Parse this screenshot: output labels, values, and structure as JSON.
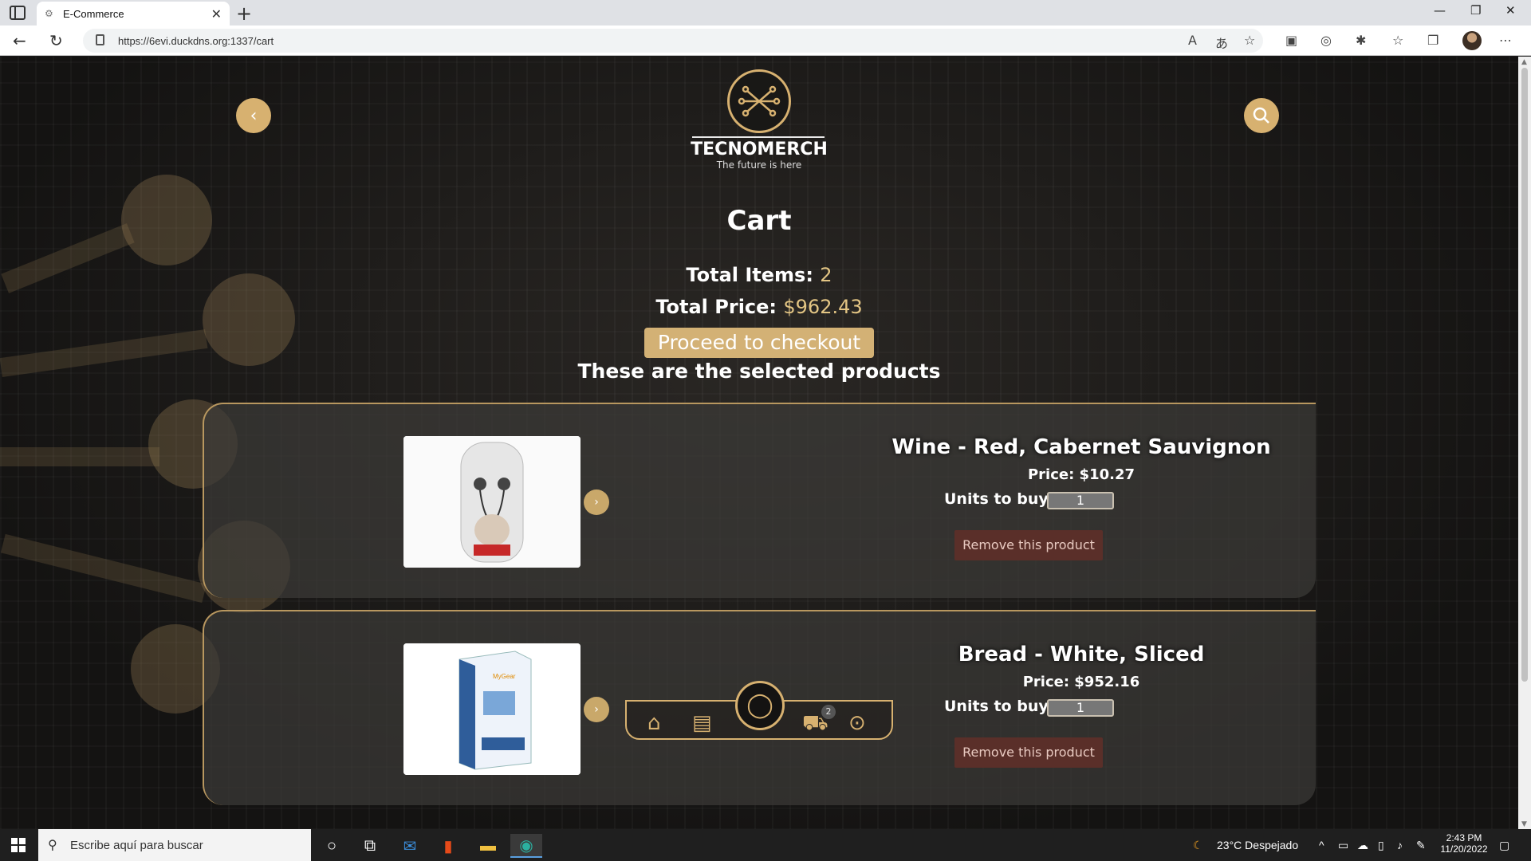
{
  "browser": {
    "tab_title": "E-Commerce",
    "tab_close": "✕",
    "new_tab": "+",
    "url": "https://6evi.duckdns.org:1337/cart",
    "window_controls": {
      "minimize": "—",
      "restore": "❐",
      "close": "✕"
    }
  },
  "header": {
    "brand_name": "TECNOMERCH",
    "tagline": "The future is here",
    "back_icon": "chevron-left-icon",
    "search_icon": "search-icon",
    "accent_color": "#d7b170"
  },
  "cart": {
    "title": "Cart",
    "total_items_label": "Total Items:",
    "total_items_value": "2",
    "total_price_label": "Total Price:",
    "total_price_value": "$962.43",
    "checkout_label": "Proceed to checkout",
    "selected_heading": "These are the selected products"
  },
  "products": [
    {
      "name": "Wine - Red, Cabernet Sauvignon",
      "price": "Price: $10.27",
      "units_label": "Units to buy:",
      "units_value": "1",
      "remove_label": "Remove this product",
      "image_brand": "maxell"
    },
    {
      "name": "Bread - White, Sliced",
      "price": "Price: $952.16",
      "units_label": "Units to buy:",
      "units_value": "1",
      "remove_label": "Remove this product",
      "image_label": "USB Video Capture"
    }
  ],
  "floating_nav": {
    "items": [
      "home-icon",
      "catalog-icon",
      "user-icon",
      "cart-icon",
      "chat-icon"
    ],
    "cart_badge": "2"
  },
  "taskbar": {
    "search_placeholder": "Escribe aquí para buscar",
    "weather": "23°C  Despejado",
    "time": "2:43 PM",
    "date": "11/20/2022"
  }
}
